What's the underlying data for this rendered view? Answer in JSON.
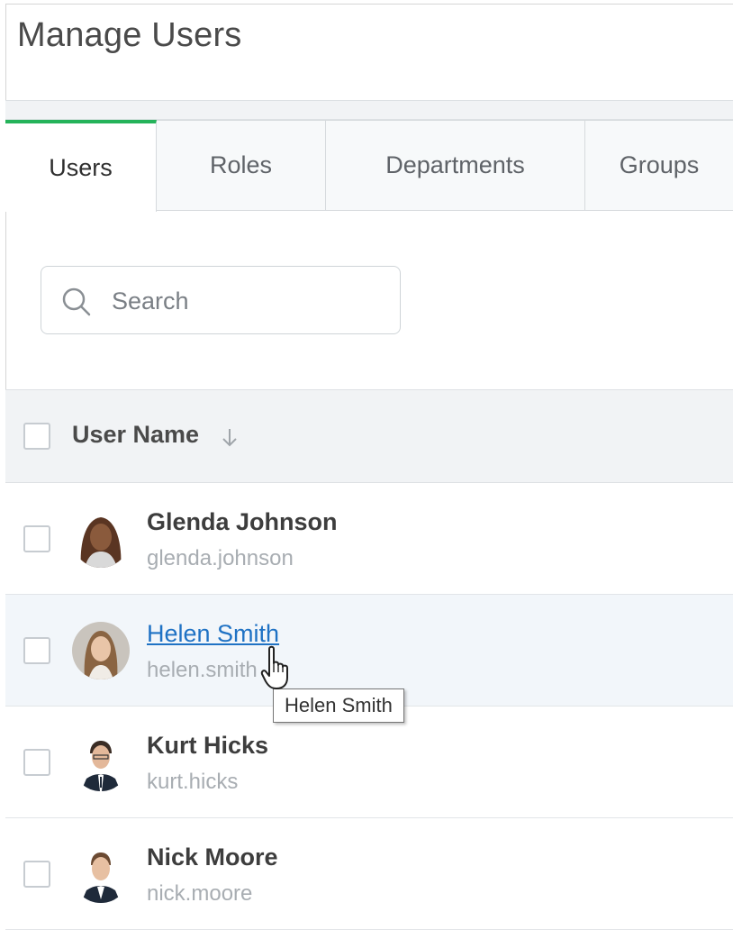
{
  "page": {
    "title": "Manage Users"
  },
  "tabs": [
    {
      "label": "Users",
      "active": true
    },
    {
      "label": "Roles",
      "active": false
    },
    {
      "label": "Departments",
      "active": false
    },
    {
      "label": "Groups",
      "active": false
    }
  ],
  "search": {
    "placeholder": "Search",
    "value": ""
  },
  "table": {
    "header": {
      "column_label": "User Name",
      "sort": "descending"
    },
    "rows": [
      {
        "name": "Glenda Johnson",
        "login": "glenda.johnson"
      },
      {
        "name": "Helen Smith",
        "login": "helen.smith"
      },
      {
        "name": "Kurt Hicks",
        "login": "kurt.hicks"
      },
      {
        "name": "Nick Moore",
        "login": "nick.moore"
      }
    ]
  },
  "tooltip": {
    "text": "Helen Smith"
  },
  "colors": {
    "accent": "#25b35a",
    "link": "#1f72c4",
    "hover_row": "#f2f6fa"
  }
}
